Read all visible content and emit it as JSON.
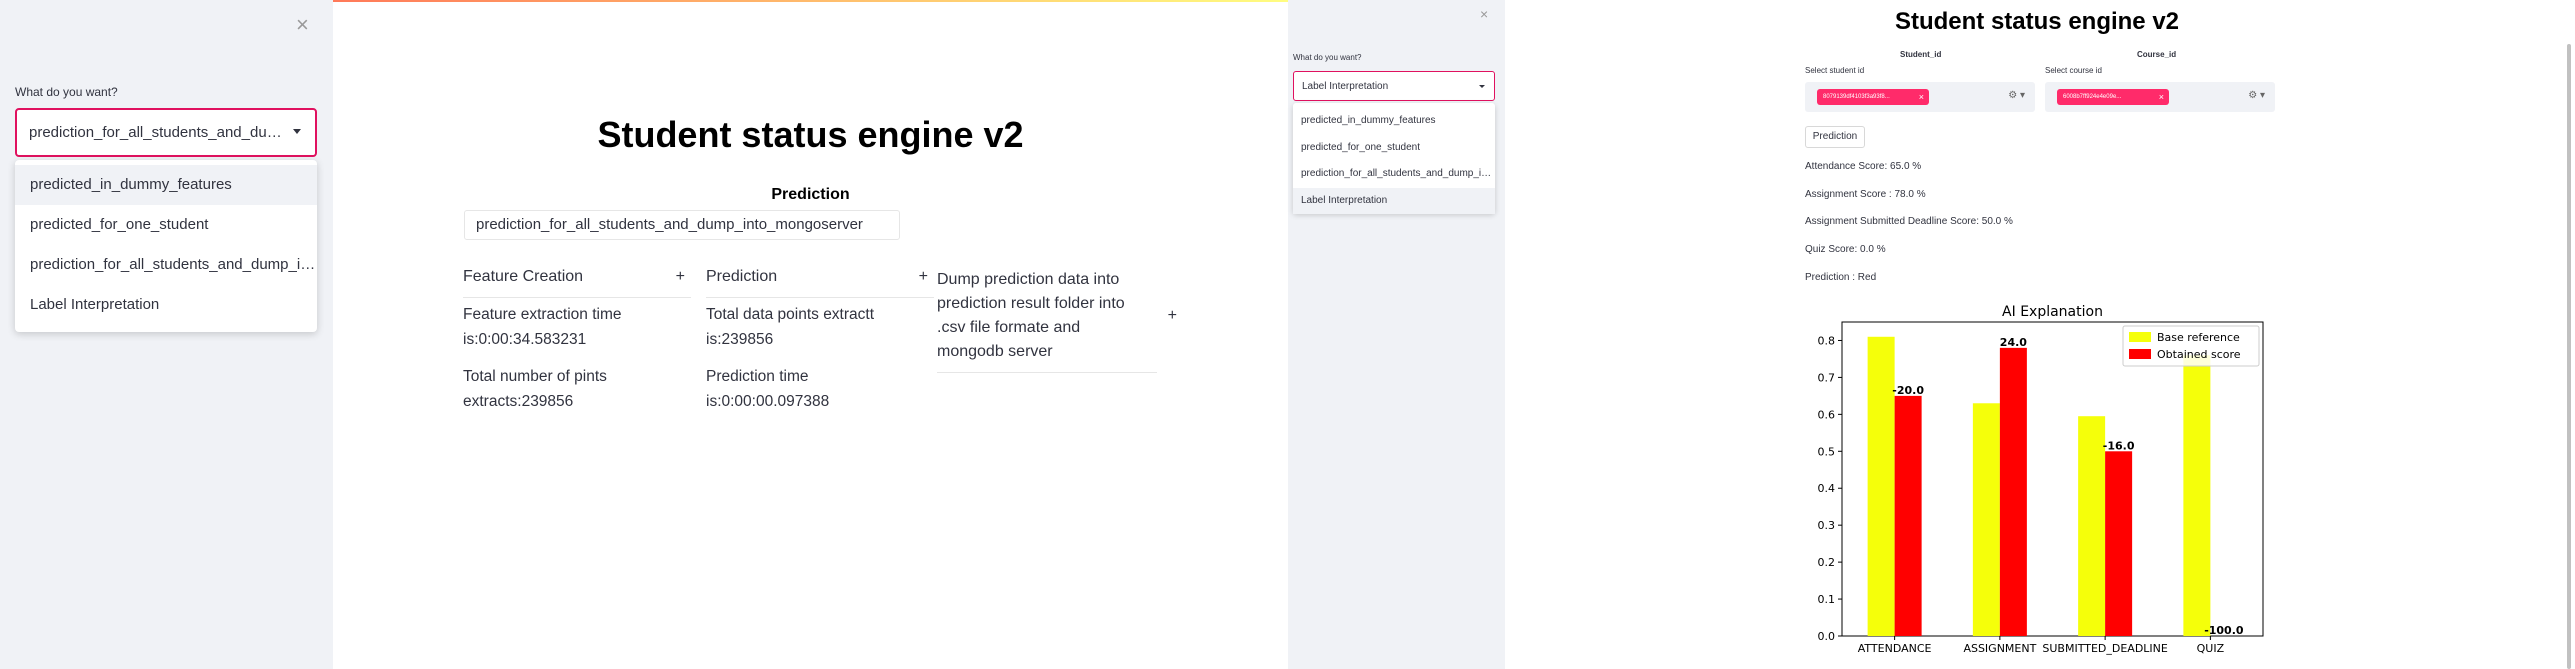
{
  "screen1": {
    "sidebar": {
      "label": "What do you want?",
      "selected": "prediction_for_all_students_and_dump_into_mongoserver",
      "options": [
        "predicted_in_dummy_features",
        "predicted_for_one_student",
        "prediction_for_all_students_and_dump_into_mongoserver",
        "Label Interpretation"
      ],
      "close": "×"
    },
    "title": "Student status engine v2",
    "prediction_heading": "Prediction",
    "prediction_value": "prediction_for_all_students_and_dump_into_mongoserver",
    "columns": [
      {
        "header": "Feature Creation",
        "lines": [
          "Feature extraction time is:0:00:34.583231",
          "Total number of pints extracts:239856"
        ]
      },
      {
        "header": "Prediction",
        "lines": [
          "Total data points extractt is:239856",
          "Prediction time is:0:00:00.097388"
        ]
      },
      {
        "header": "Dump prediction data into prediction result folder into .csv file formate and mongodb server",
        "lines": []
      }
    ],
    "expand": "+"
  },
  "screen2": {
    "sidebar": {
      "label": "What do you want?",
      "selected": "Label Interpretation",
      "options": [
        "predicted_in_dummy_features",
        "predicted_for_one_student",
        "prediction_for_all_students_and_dump_into_mongoserver",
        "Label Interpretation"
      ],
      "close": "×"
    },
    "title": "Student status engine v2",
    "student": {
      "header": "Student_id",
      "label": "Select student id",
      "tag": "8079139df4103f3a93f8..."
    },
    "course": {
      "header": "Course_id",
      "label": "Select course id",
      "tag": "6008b7ff924e4e09e..."
    },
    "prediction_button": "Prediction",
    "scores": [
      "Attendance Score: 65.0 %",
      "Assignment Score : 78.0 %",
      "Assignment Submitted Deadline Score: 50.0 %",
      "Quiz Score: 0.0 %",
      "Prediction : Red"
    ]
  },
  "chart_data": {
    "type": "bar",
    "title": "AI Explanation",
    "categories": [
      "ATTENDANCE",
      "ASSIGNMENT",
      "SUBMITTED_DEADLINE",
      "QUIZ"
    ],
    "series": [
      {
        "name": "Base reference",
        "color": "#f5ff0a",
        "values": [
          0.81,
          0.63,
          0.595,
          0.76
        ]
      },
      {
        "name": "Obtained score",
        "color": "#ff0000",
        "values": [
          0.65,
          0.78,
          0.5,
          0.0
        ]
      }
    ],
    "annotations": [
      "-20.0",
      "24.0",
      "-16.0",
      "-100.0"
    ],
    "ylim": [
      0,
      0.85
    ],
    "yticks": [
      "0.0",
      "0.1",
      "0.2",
      "0.3",
      "0.4",
      "0.5",
      "0.6",
      "0.7",
      "0.8"
    ],
    "legend": "top-right"
  }
}
